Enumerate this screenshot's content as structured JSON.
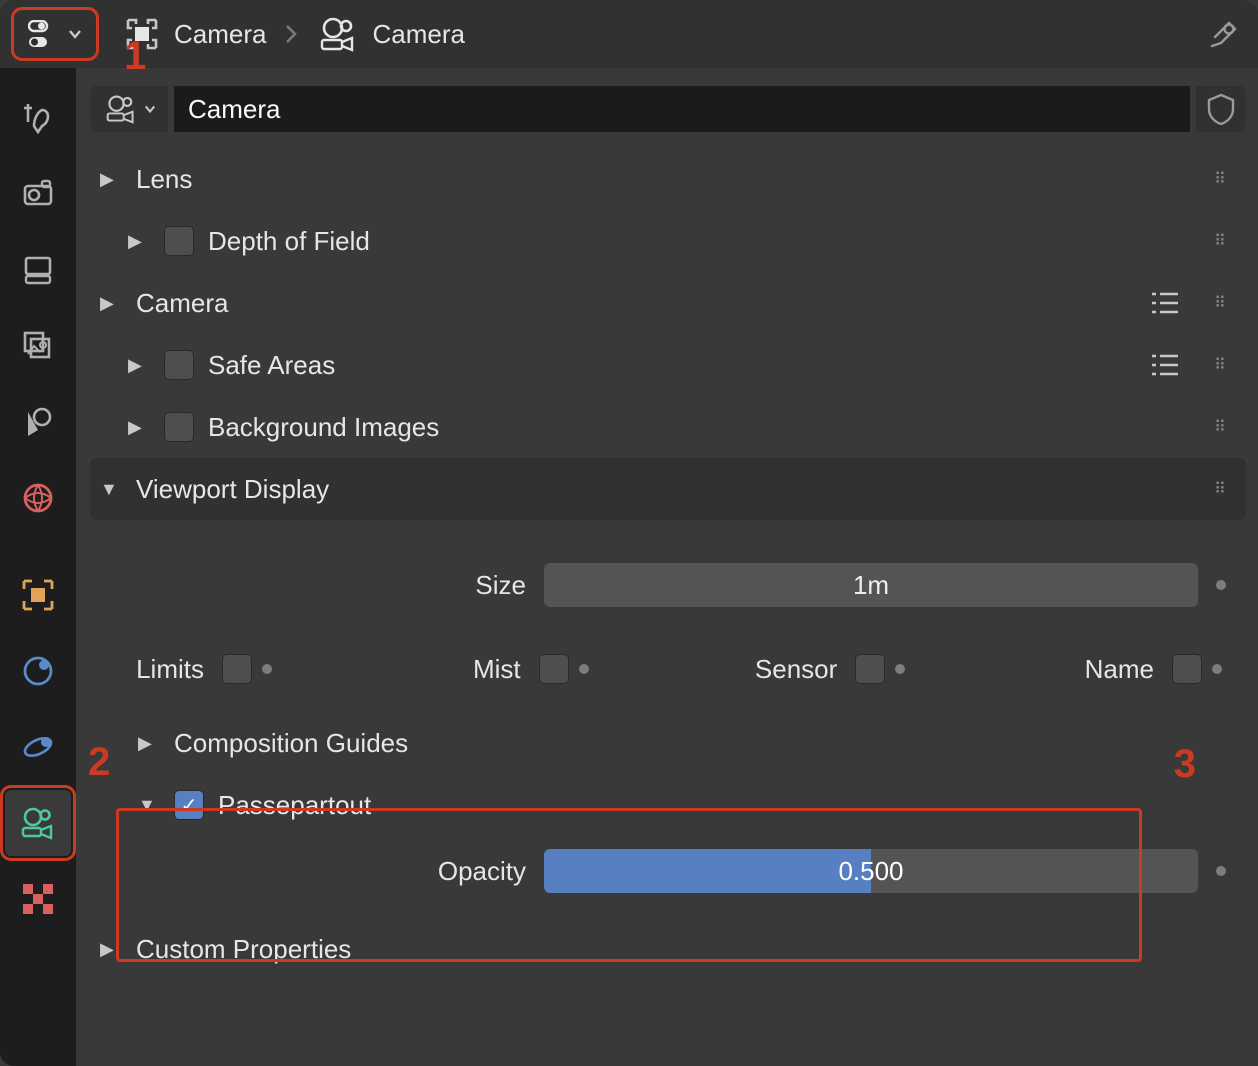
{
  "header": {
    "breadcrumb_object_label": "Camera",
    "breadcrumb_data_label": "Camera"
  },
  "datablock": {
    "name": "Camera"
  },
  "panels": {
    "lens": "Lens",
    "depth_of_field": "Depth of Field",
    "camera": "Camera",
    "safe_areas": "Safe Areas",
    "background_images": "Background Images",
    "viewport_display": "Viewport Display",
    "composition_guides": "Composition Guides",
    "passepartout": "Passepartout",
    "custom_properties": "Custom Properties"
  },
  "viewport": {
    "size_label": "Size",
    "size_value": "1m",
    "limits_label": "Limits",
    "mist_label": "Mist",
    "sensor_label": "Sensor",
    "name_label": "Name",
    "opacity_label": "Opacity",
    "opacity_value": "0.500"
  },
  "annotations": {
    "n1": "1",
    "n2": "2",
    "n3": "3"
  }
}
